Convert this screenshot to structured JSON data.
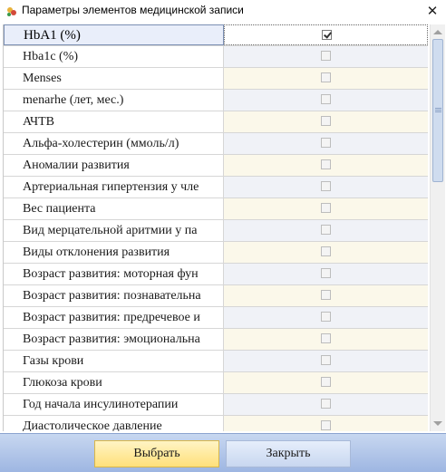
{
  "window": {
    "title": "Параметры элементов медицинской записи"
  },
  "rows": [
    {
      "label": "HbA1 (%)",
      "checked": true
    },
    {
      "label": "Hba1c (%)",
      "checked": false
    },
    {
      "label": "Menses",
      "checked": false
    },
    {
      "label": "menarhe (лет, мес.)",
      "checked": false
    },
    {
      "label": "АЧТВ",
      "checked": false
    },
    {
      "label": "Альфа-холестерин (ммоль/л)",
      "checked": false
    },
    {
      "label": "Аномалии развития",
      "checked": false
    },
    {
      "label": "Артериальная гипертензия у чле",
      "checked": false
    },
    {
      "label": "Вес пациента",
      "checked": false
    },
    {
      "label": "Вид мерцательной аритмии у па",
      "checked": false
    },
    {
      "label": "Виды отклонения развития",
      "checked": false
    },
    {
      "label": "Возраст развития: моторная фун",
      "checked": false
    },
    {
      "label": "Возраст развития: познавательна",
      "checked": false
    },
    {
      "label": "Возраст развития: предречевое и",
      "checked": false
    },
    {
      "label": "Возраст развития: эмоциональна",
      "checked": false
    },
    {
      "label": "Газы крови",
      "checked": false
    },
    {
      "label": "Глюкоза крови",
      "checked": false
    },
    {
      "label": "Год начала инсулинотерапии",
      "checked": false
    },
    {
      "label": "Диастолическое давление",
      "checked": false
    }
  ],
  "buttons": {
    "select": "Выбрать",
    "close": "Закрыть"
  }
}
